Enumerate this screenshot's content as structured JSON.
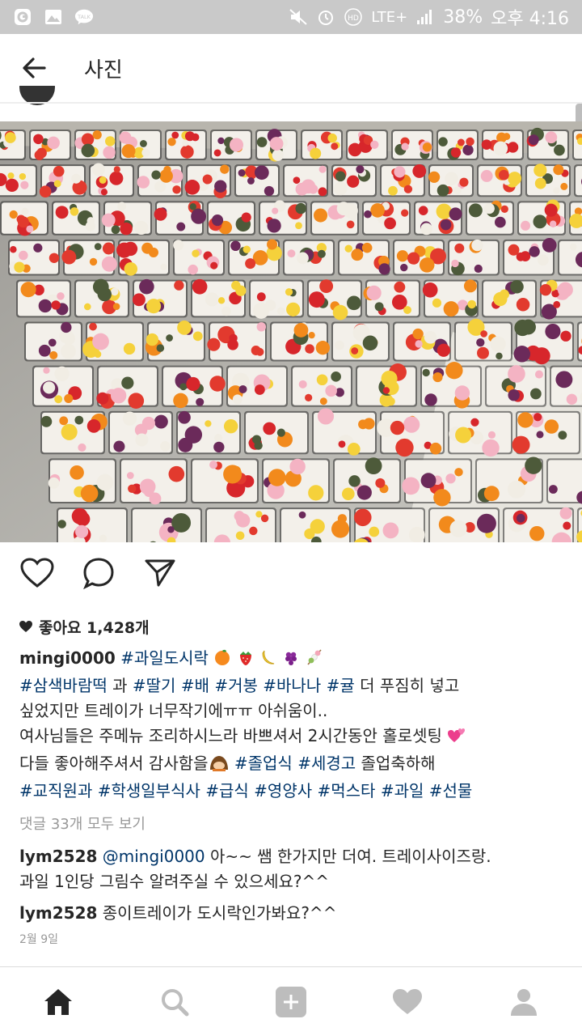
{
  "status_bar": {
    "battery": "38%",
    "network": "LTE+",
    "time": "오후 4:16",
    "left_icons": [
      "app-icon",
      "gallery-icon",
      "talk-icon"
    ],
    "talk_label": "TALK",
    "hd_label": "HD"
  },
  "app_bar": {
    "title": "사진"
  },
  "post": {
    "likes_text": "좋아요 1,428개",
    "username": "mingi0000",
    "caption_line1_tag": "#과일도시락",
    "caption_line2": {
      "tag1": "#삼색바람떡",
      "and": " 과 ",
      "tag2": "#딸기",
      "tag3": "#배",
      "tag4": "#거봉",
      "tag5": "#바나나",
      "tag6": "#귤",
      "rest": " 더 푸짐히 넣고"
    },
    "caption_line3": "싶었지만 트레이가 너무작기에ㅠㅠ 아쉬움이..",
    "caption_line4": "여사님들은 주메뉴 조리하시느라 바쁘셔서 2시간동안 홀로셋팅",
    "caption_line5_text": "다들 좋아해주셔서 감사함을",
    "caption_line5_tag1": "#졸업식",
    "caption_line5_tag2": "#세경고",
    "caption_line5_rest": " 졸업축하해",
    "caption_line6_tags": [
      "#교직원과",
      "#학생일부식사",
      "#급식",
      "#영양사",
      "#먹스타",
      "#과일",
      "#선물"
    ],
    "view_all_comments": "댓글 33개 모두 보기",
    "comments": [
      {
        "user": "lym2528",
        "mention": "@mingi0000",
        "text1": " 아~~ 쌤 한가지만 더여. 트레이사이즈랑.",
        "text2": "과일 1인당 그림수 알려주실 수 있으세요?^^"
      },
      {
        "user": "lym2528",
        "text1": " 종이트레이가 도시락인가봐요?^^"
      }
    ],
    "date": "2월 9일"
  },
  "colors": {
    "status_bar_bg": "#c9c9c9",
    "hashtag": "#003569",
    "text": "#262626",
    "muted": "#999999"
  },
  "bottom_nav": [
    "home-icon",
    "search-icon",
    "add-icon",
    "activity-heart-icon",
    "profile-icon"
  ]
}
